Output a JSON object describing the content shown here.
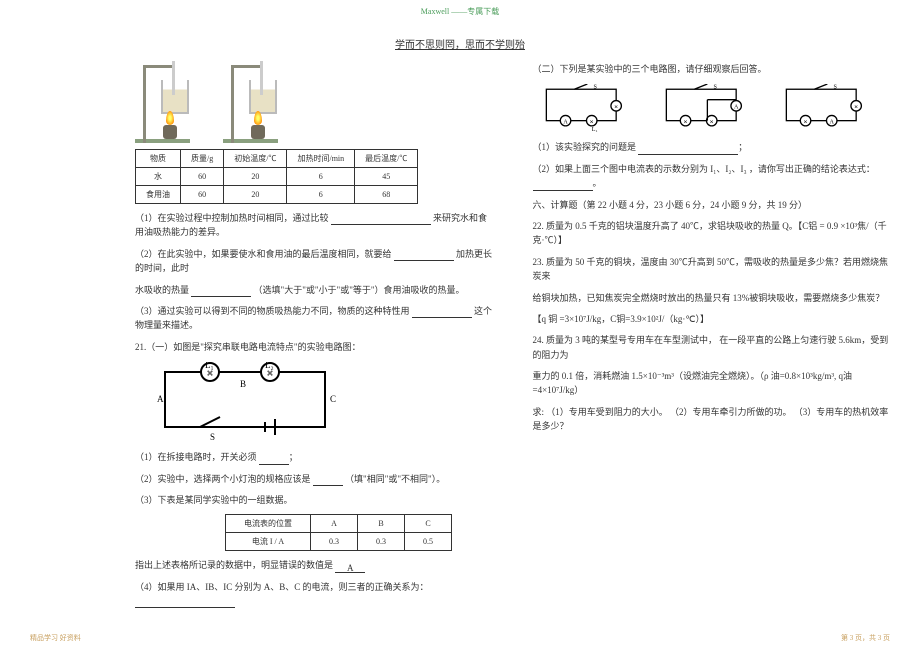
{
  "watermark": "Maxwell ——专属下载",
  "header": "学而不思则罔，思而不学则殆",
  "left": {
    "table1": {
      "headers": [
        "物质",
        "质量/g",
        "初始温度/℃",
        "加热时间/min",
        "最后温度/℃"
      ],
      "row1": [
        "水",
        "60",
        "20",
        "6",
        "45"
      ],
      "row2": [
        "食用油",
        "60",
        "20",
        "6",
        "68"
      ]
    },
    "q1": "（1）在实验过程中控制加热时间相同，通过比较",
    "q1_end": "来研究水和食用油吸热能力的差异。",
    "q2a": "（2）在此实验中，如果要使水和食用油的最后温度相同，就要给",
    "q2b": "加热更长的时间，此时",
    "q2c": "水吸收的热量",
    "q2d": "（选填\"大于\"或\"小于\"或\"等于\"）食用油吸收的热量。",
    "q3a": "（3）通过实验可以得到不同的物质吸热能力不同，物质的这种特性用",
    "q3b": "这个物理量来描述。",
    "q21": "21.（一）如图是\"探究串联电路电流特点\"的实验电路图：",
    "q21_1": "（1）在拆接电路时，开关必须",
    "q21_2a": "（2）实验中，选择两个小灯泡的规格应该是",
    "q21_2b": "（填\"相同\"或\"不相同\"）。",
    "q21_3": "（3）下表是某同学实验中的一组数据。",
    "table2": {
      "r1_label": "电流表的位置",
      "r1": [
        "A",
        "B",
        "C"
      ],
      "r2_label": "电流 I / A",
      "r2": [
        "0.3",
        "0.3",
        "0.5"
      ]
    },
    "q21_3b": "指出上述表格所记录的数据中，明显错误的数值是",
    "q21_3c": "A",
    "q21_4a": "（4）如果用 IA、IB、IC 分别为 A、B、C 的电流，则三者的正确关系为："
  },
  "right": {
    "part2": "（二）下列是某实验中的三个电路图，请仔细观察后回答。",
    "q1": "（1）该实验探究的问题是",
    "q2a": "（2）如果上面三个图中电流表的示数分别为",
    "q2b": "I₁、I₂、I₃",
    "q2c": "，请你写出正确的结论表达式：",
    "section6": "六、计算题（第 22 小题 4 分，23 小题 6 分，24 小题 9 分，共 19 分）",
    "q22a": "22. 质量为 0.5 千克的铝块温度升高了 40℃，求铝块吸收的热量  Q。【C铝 = 0.9 ×10³焦/（千克·℃）】",
    "q23a": "23. 质量为 50 千克的铜块，温度由 30℃升高到 50℃，需吸收的热量是多少焦？若用燃烧焦炭来",
    "q23b": "给铜块加热，已知焦炭完全燃烧时放出的热量只有 13%被铜块吸收，需要燃烧多少焦炭？",
    "q23c": "【q 铜 =3×10⁷J/kg，C铜=3.9×10²J/（kg·℃）】",
    "q24a": "24. 质量为 3 吨的某型号专用车在车型测试中， 在一段平直的公路上匀速行驶  5.6km，受到的阻力为",
    "q24b": "重力的 0.1 倍，消耗燃油 1.5×10⁻³m³（设燃油完全燃烧）。（ρ 油=0.8×10³kg/m³, q油=4×10⁷J/kg）",
    "q24c": "求: （1）专用车受到阻力的大小。 （2）专用车牵引力所做的功。 （3）专用车的热机效率是多少？"
  },
  "footer": {
    "left": "精品学习  好资料",
    "right": "第 3 页，共 3 页"
  }
}
